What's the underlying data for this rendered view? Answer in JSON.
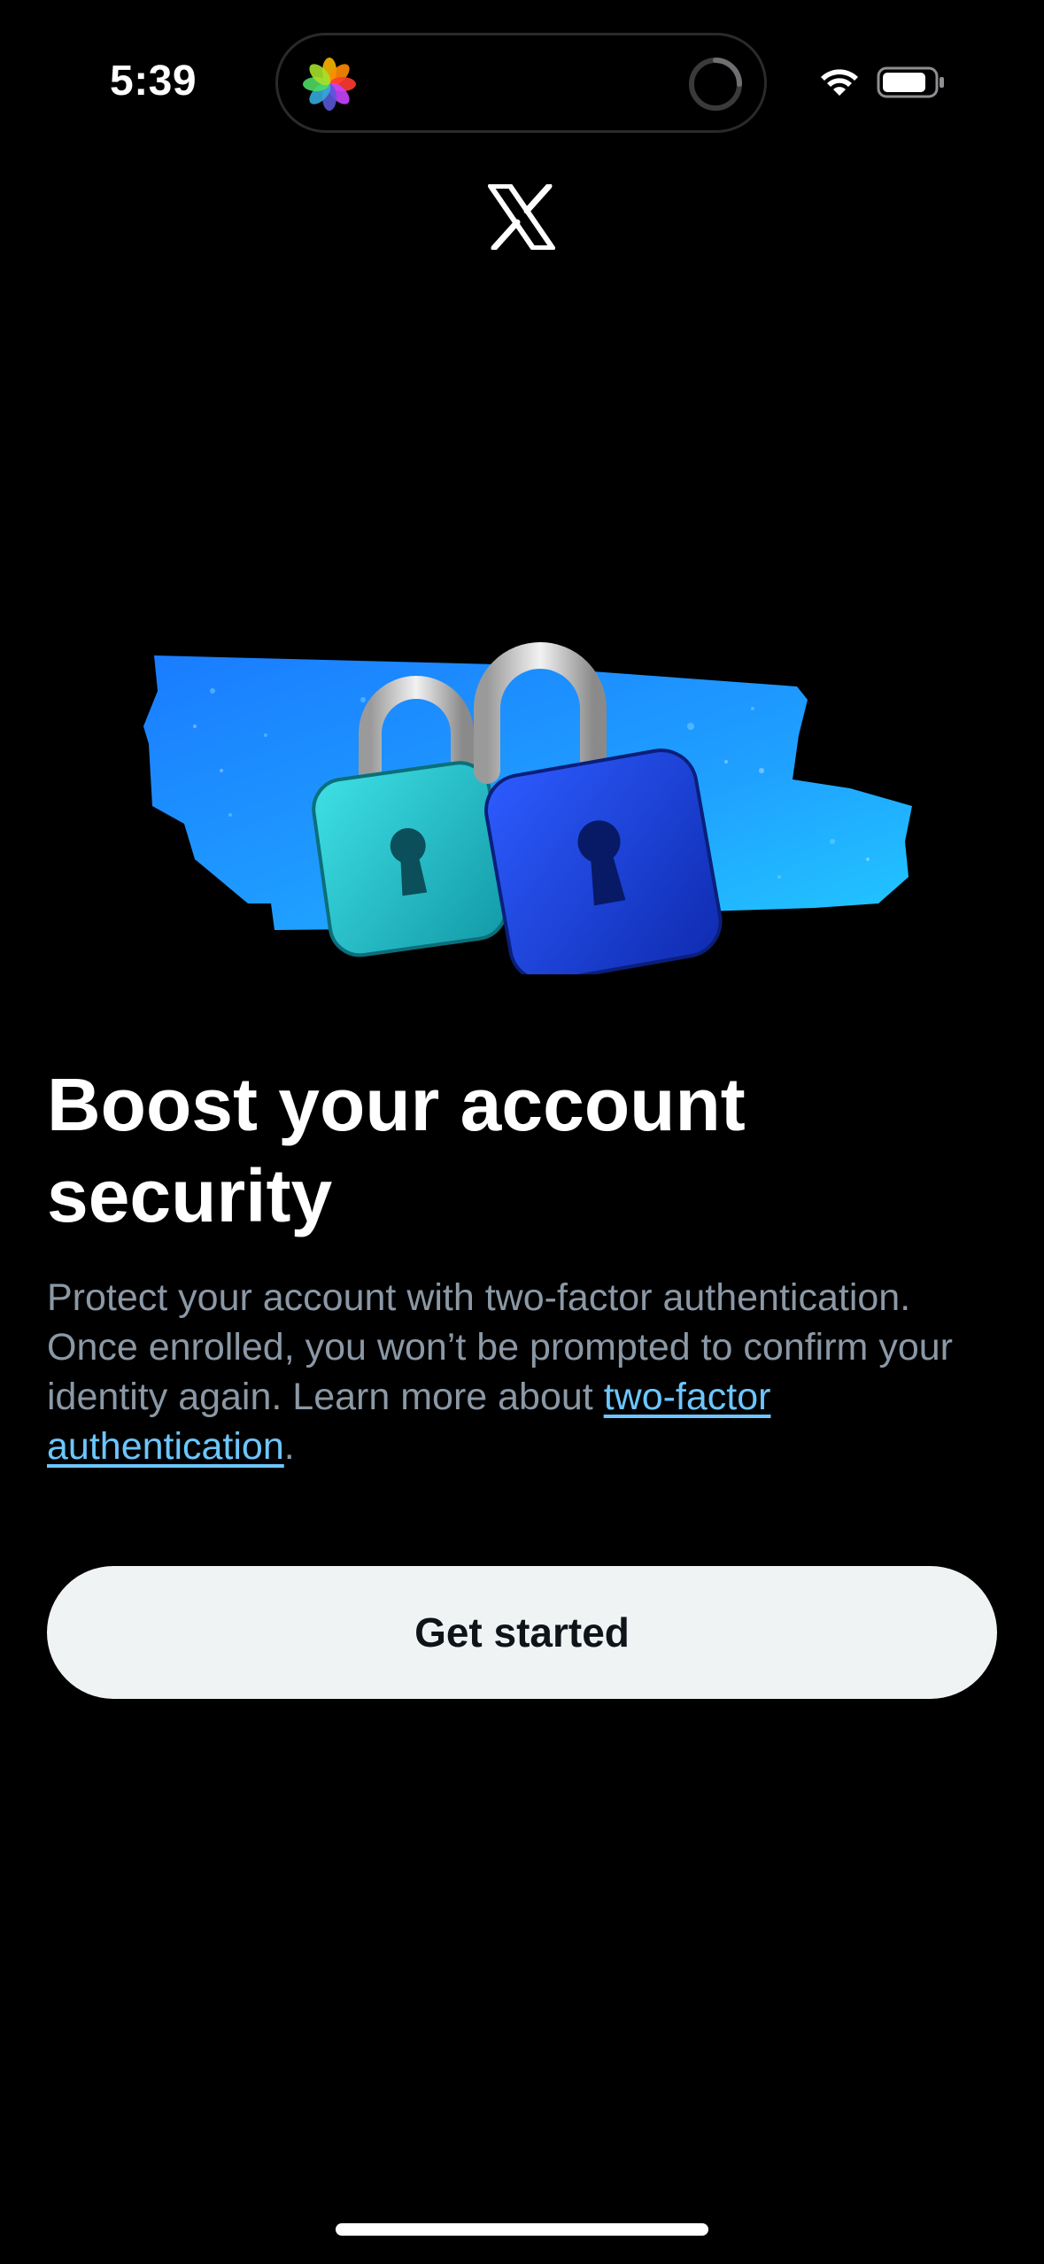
{
  "status_bar": {
    "time": "5:39",
    "icons": [
      "photos-icon",
      "loading-spinner-icon",
      "wifi-icon",
      "battery-icon"
    ]
  },
  "header": {
    "logo": "x-logo-icon"
  },
  "hero": {
    "illustration": "padlocks-illustration",
    "colors": {
      "tape_blue": "#1e90ff",
      "lock_teal": "#1ec6cf",
      "lock_blue": "#1d3fd8"
    }
  },
  "content": {
    "title": "Boost your account security",
    "description_prefix": "Protect your account with two-factor authentication. Once enrolled, you won’t be prompted to confirm your identity again. Learn more about ",
    "description_link": "two-factor authentication",
    "description_suffix": "."
  },
  "actions": {
    "get_started_label": "Get started"
  },
  "colors": {
    "background": "#000000",
    "text_primary": "#ffffff",
    "text_secondary": "#8b98a5",
    "link": "#6cc6ff",
    "button_bg": "#eff3f4",
    "button_text": "#0f1419"
  }
}
